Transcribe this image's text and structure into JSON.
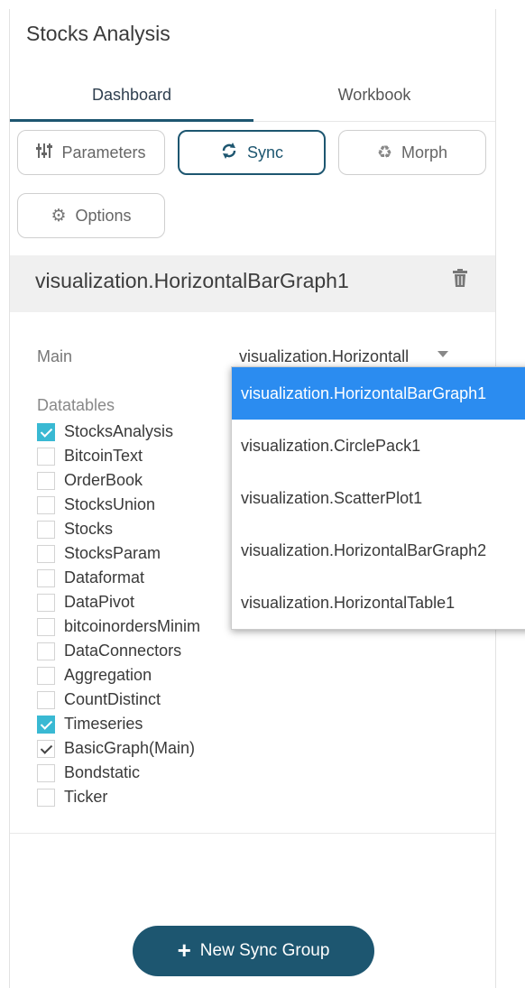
{
  "panel": {
    "title": "Stocks Analysis"
  },
  "tabs": [
    {
      "label": "Dashboard",
      "active": true
    },
    {
      "label": "Workbook",
      "active": false
    }
  ],
  "toolbar": {
    "parameters_label": "Parameters",
    "sync_label": "Sync",
    "morph_label": "Morph",
    "options_label": "Options"
  },
  "icons": {
    "parameters": "sliders-icon",
    "sync": "sync-icon",
    "morph": "recycle-icon",
    "options": "gear-icon",
    "delete": "trash-icon",
    "dropdown": "chevron-down-icon",
    "add": "plus-icon"
  },
  "visualization": {
    "name": "visualization.HorizontalBarGraph1"
  },
  "main": {
    "label": "Main",
    "selected": "visualization.HorizontalBarGraph1",
    "selected_display": "visualization.Horizontall"
  },
  "datatables": {
    "label": "Datatables",
    "items": [
      {
        "label": "StocksAnalysis",
        "state": "checked"
      },
      {
        "label": "BitcoinText",
        "state": "unchecked"
      },
      {
        "label": "OrderBook",
        "state": "unchecked"
      },
      {
        "label": "StocksUnion",
        "state": "unchecked"
      },
      {
        "label": "Stocks",
        "state": "unchecked"
      },
      {
        "label": "StocksParam",
        "state": "unchecked"
      },
      {
        "label": "Dataformat",
        "state": "unchecked"
      },
      {
        "label": "DataPivot",
        "state": "unchecked"
      },
      {
        "label": "bitcoinordersMinim",
        "state": "unchecked"
      },
      {
        "label": "DataConnectors",
        "state": "unchecked"
      },
      {
        "label": "Aggregation",
        "state": "unchecked"
      },
      {
        "label": "CountDistinct",
        "state": "unchecked"
      },
      {
        "label": "Timeseries",
        "state": "checked"
      },
      {
        "label": "BasicGraph(Main)",
        "state": "main"
      },
      {
        "label": "Bondstatic",
        "state": "unchecked"
      },
      {
        "label": "Ticker",
        "state": "unchecked"
      }
    ]
  },
  "dropdown_options": [
    {
      "label": "visualization.HorizontalBarGraph1",
      "selected": true
    },
    {
      "label": "visualization.CirclePack1",
      "selected": false
    },
    {
      "label": "visualization.ScatterPlot1",
      "selected": false
    },
    {
      "label": "visualization.HorizontalBarGraph2",
      "selected": false
    },
    {
      "label": "visualization.HorizontalTable1",
      "selected": false
    }
  ],
  "footer": {
    "new_sync_group_label": "New Sync Group"
  },
  "colors": {
    "accent": "#1d5670",
    "checkbox_checked": "#39b9d3",
    "dropdown_selected": "#2b8cf0"
  }
}
